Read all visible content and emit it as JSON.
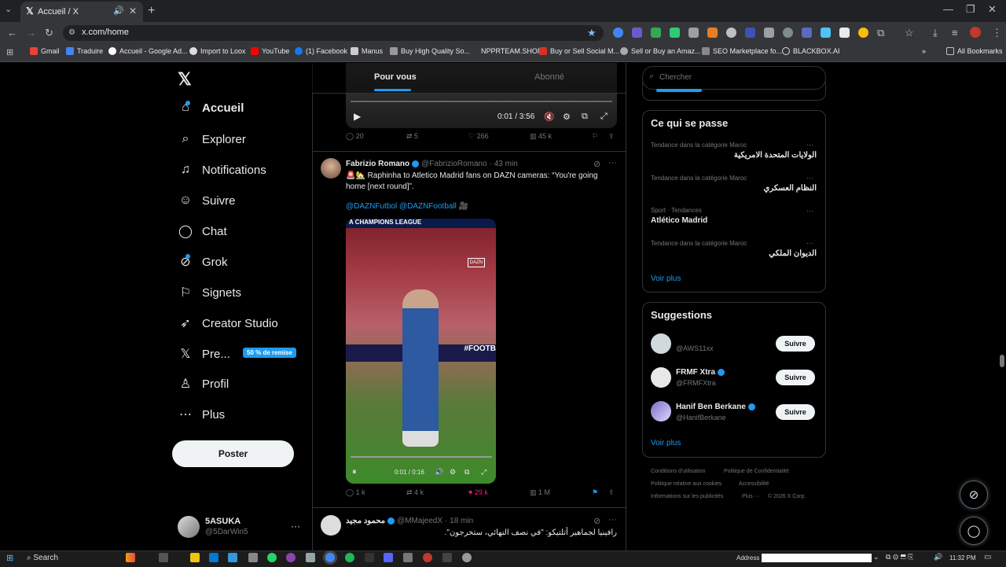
{
  "browser": {
    "tab_title": "Accueil / X",
    "url": "x.com/home",
    "bookmarks": [
      "Gmail",
      "Traduire",
      "Accueil - Google Ad...",
      "Import to Loox",
      "YouTube",
      "(1) Facebook",
      "Manus",
      "Buy High Quality So...",
      "NPPRTEAM.SHOP",
      "Buy or Sell Social M...",
      "Sell or Buy an Amaz...",
      "SEO Marketplace fo...",
      "BLACKBOX.AI"
    ],
    "all_bookmarks": "All Bookmarks"
  },
  "nav": {
    "items": [
      "Accueil",
      "Explorer",
      "Notifications",
      "Suivre",
      "Chat",
      "Grok",
      "Signets",
      "Creator Studio",
      "Pre...",
      "Profil",
      "Plus"
    ],
    "premium_badge": "50 % de remise",
    "post_button": "Poster",
    "user_name": "5ASUKA",
    "user_handle": "@5DarWin5"
  },
  "feed": {
    "tabs": [
      "Pour vous",
      "Abonné"
    ],
    "top_video_time": "0:01 / 3:56",
    "top_actions": {
      "replies": "20",
      "reposts": "5",
      "likes": "266",
      "views": "45 k"
    },
    "tweet1": {
      "name": "Fabrizio Romano",
      "handle": "@FabrizioRomano",
      "time": "· 43 min",
      "text": "🚨🏡 Raphinha to Atletico Madrid fans on DAZN cameras: “You're going home [next round]”.",
      "mentions": "@DAZNFutbol @DAZNFootball 🎥",
      "video_banner": "A CHAMPIONS LEAGUE",
      "video_logo": "DAZN",
      "video_board": "#FOOTB",
      "video_time": "0:01 / 0:16",
      "actions": {
        "replies": "1 k",
        "reposts": "4 k",
        "likes": "29 k",
        "views": "1 M"
      }
    },
    "tweet2": {
      "name": "محمود مجيد",
      "handle": "@MMajeedX",
      "time": "· 18 min",
      "text": "رافينيا لجماهير أتلتيكو: \"في نصف النهائي، ستخرجون\"."
    }
  },
  "sidebar": {
    "search_placeholder": "Chercher",
    "trends_title": "Ce qui se passe",
    "trends": [
      {
        "ctx": "Tendance dans la catégorie Maroc",
        "name": "الولايات المتحدة الامريكية"
      },
      {
        "ctx": "Tendance dans la catégorie Maroc",
        "name": "النظام العسكري"
      },
      {
        "ctx": "Sport · Tendances",
        "name": "Atlético Madrid"
      },
      {
        "ctx": "Tendance dans la catégorie Maroc",
        "name": "الديوان الملكي"
      }
    ],
    "see_more": "Voir plus",
    "suggestions_title": "Suggestions",
    "suggestions": [
      {
        "name": "",
        "handle": "@AWS11xx"
      },
      {
        "name": "FRMF Xtra",
        "handle": "@FRMFXtra"
      },
      {
        "name": "Hanif Ben Berkane",
        "handle": "@HanifBerkane"
      }
    ],
    "follow_label": "Suivre",
    "footer": [
      "Conditions d'utilisation",
      "Politique de Confidentialité",
      "Politique relative aux cookies",
      "Accessibilité",
      "Informations sur les publicités",
      "Plus ···",
      "© 2026 X Corp."
    ]
  },
  "taskbar": {
    "search": "Search",
    "address": "Address",
    "time": "11:32 PM"
  },
  "colors": {
    "accent": "#1d9bf0",
    "like": "#f91880",
    "bg": "#000000"
  }
}
